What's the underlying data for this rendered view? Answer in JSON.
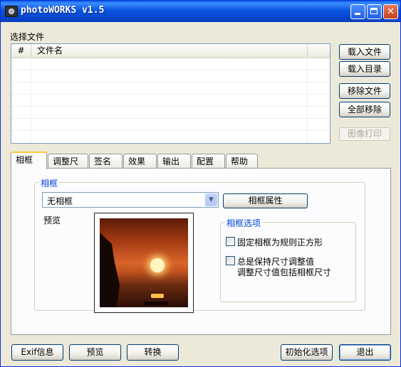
{
  "window": {
    "title": "photoWORKS v1.5",
    "close_glyph": "✕"
  },
  "files": {
    "section_label": "选择文件",
    "columns": [
      "#",
      "文件名"
    ],
    "buttons": {
      "load_file": "载入文件",
      "load_dir": "载入目录",
      "remove_file": "移除文件",
      "remove_all": "全部移除",
      "print_image": "图像打印"
    }
  },
  "tabs": [
    "相框",
    "调整尺寸",
    "签名",
    "效果",
    "输出",
    "配置",
    "帮助"
  ],
  "frame_tab": {
    "group_title": "相框",
    "combo_value": "无相框",
    "combo_arrow": "▼",
    "properties_button": "相框属性",
    "preview_label": "预览",
    "options_title": "相框选项",
    "option1": "固定相框为规则正方形",
    "option2_line1": "总是保持尺寸调整值",
    "option2_line2": "调整尺寸值包括相框尺寸",
    "option1_checked": false,
    "option2_checked": false
  },
  "bottom": {
    "exif": "Exif信息",
    "preview": "预览",
    "convert": "转换",
    "init_options": "初始化选项",
    "exit": "退出"
  },
  "colors": {
    "titlebar": "#0A55DF",
    "accent": "#FFC83C",
    "group_title": "#0046D5"
  }
}
